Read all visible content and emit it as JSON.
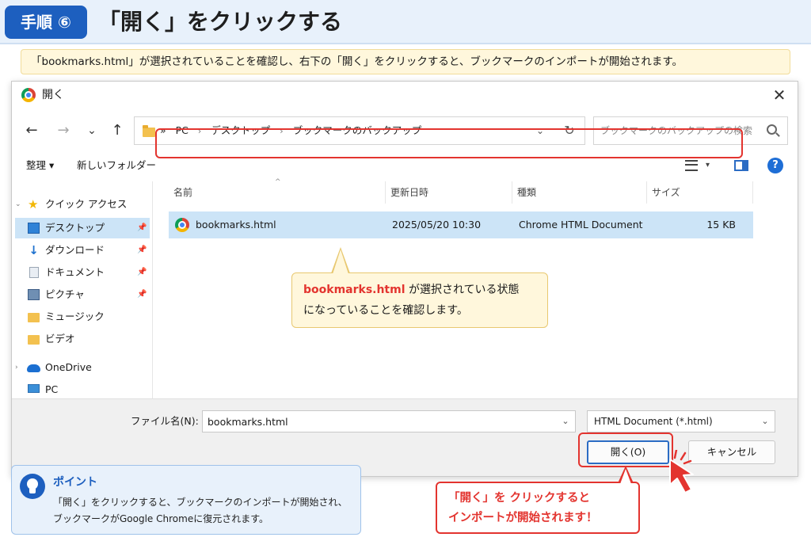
{
  "step": {
    "badge": "手順 ⑥",
    "title": "「開く」をクリックする"
  },
  "instruction": "「bookmarks.html」が選択されていることを確認し、右下の「開く」をクリックすると、ブックマークのインポートが開始されます。",
  "dialog": {
    "title": "開く",
    "close_glyph": "✕",
    "nav": {
      "back": "←",
      "forward": "→",
      "recent": "⌄",
      "up": "↑"
    },
    "address": {
      "overflow": "»",
      "separator": "›",
      "crumbs": [
        "PC",
        "デスクトップ",
        "ブックマークのバックアップ"
      ],
      "dropdown": "⌄",
      "refresh": "↻"
    },
    "search_placeholder": "ブックマークのバックアップの検索",
    "toolbar": {
      "organize": "整理 ▾",
      "new_folder": "新しいフォルダー",
      "view_caret": "▾",
      "help": "?"
    },
    "nav_pane": [
      {
        "label": "クイック アクセス",
        "icon": "star-icon",
        "expander": "⌄",
        "pinned": false
      },
      {
        "label": "デスクトップ",
        "icon": "desktop-icon",
        "pinned": true,
        "selected": true
      },
      {
        "label": "ダウンロード",
        "icon": "download-icon",
        "pinned": true
      },
      {
        "label": "ドキュメント",
        "icon": "document-icon",
        "pinned": true
      },
      {
        "label": "ピクチャ",
        "icon": "pictures-icon",
        "pinned": true
      },
      {
        "label": "ミュージック",
        "icon": "music-folder-icon",
        "pinned": false
      },
      {
        "label": "ビデオ",
        "icon": "video-folder-icon",
        "pinned": false
      },
      {
        "label": "OneDrive",
        "icon": "onedrive-icon",
        "expander": "›",
        "pinned": false
      },
      {
        "label": "PC",
        "icon": "pc-icon",
        "pinned": false
      }
    ],
    "pin_glyph": "📌",
    "columns": [
      "名前",
      "更新日時",
      "種類",
      "サイズ"
    ],
    "sort_caret": "^",
    "file": {
      "name": "bookmarks.html",
      "modified": "2025/05/20 10:30",
      "type": "Chrome HTML Document",
      "size": "15 KB"
    },
    "filename_label": "ファイル名(N):",
    "filename_value": "bookmarks.html",
    "combo_arrow": "⌄",
    "filetype": "HTML Document (*.html)",
    "open_button": "開く(O)",
    "cancel_button": "キャンセル"
  },
  "callout_mid": {
    "highlight": "bookmarks.html",
    "line1_rest": " が選択されている状態",
    "line2": "になっていることを確認します。"
  },
  "tip": {
    "title": "ポイント",
    "line1": "「開く」をクリックすると、ブックマークのインポートが開始され、",
    "line2": "ブックマークがGoogle Chromeに復元されます。"
  },
  "callout_red": {
    "line1": "「開く」を クリックすると",
    "line2": "インポートが開始されます！"
  },
  "colors": {
    "accent_red": "#e3342f",
    "header_blue": "#1d5fbf",
    "selection": "#cce4f7"
  }
}
